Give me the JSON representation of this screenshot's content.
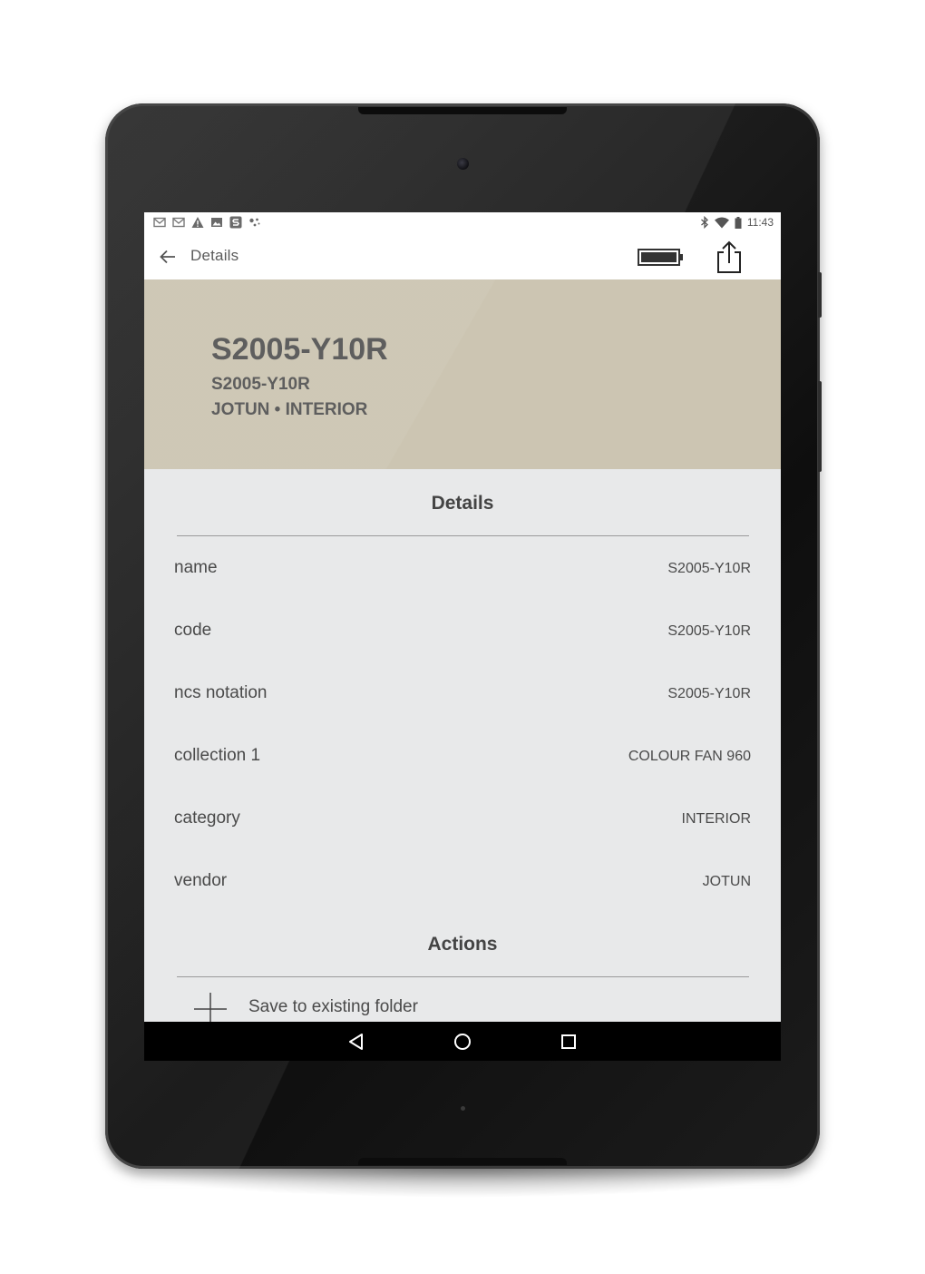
{
  "status_bar": {
    "time": "11:43",
    "left_icons": [
      "gmail-icon",
      "gmail-icon",
      "alert-icon",
      "image-icon",
      "app-s-icon",
      "dots-icon"
    ],
    "right_icons": [
      "bluetooth-icon",
      "wifi-icon",
      "battery-icon"
    ]
  },
  "app_bar": {
    "title": "Details"
  },
  "hero": {
    "color_hex": "#ccc5b2",
    "title": "S2005-Y10R",
    "subtitle": "S2005-Y10R",
    "meta": "JOTUN • INTERIOR"
  },
  "details": {
    "heading": "Details",
    "rows": [
      {
        "label": "name",
        "value": "S2005-Y10R"
      },
      {
        "label": "code",
        "value": "S2005-Y10R"
      },
      {
        "label": "ncs notation",
        "value": "S2005-Y10R"
      },
      {
        "label": "collection 1",
        "value": "COLOUR FAN 960"
      },
      {
        "label": "category",
        "value": "INTERIOR"
      },
      {
        "label": "vendor",
        "value": "JOTUN"
      }
    ]
  },
  "actions": {
    "heading": "Actions",
    "items": [
      {
        "label": "Save to existing folder",
        "icon": "plus-icon"
      }
    ]
  },
  "nav": {
    "buttons": [
      "back-triangle-icon",
      "home-circle-icon",
      "recents-square-icon"
    ]
  }
}
